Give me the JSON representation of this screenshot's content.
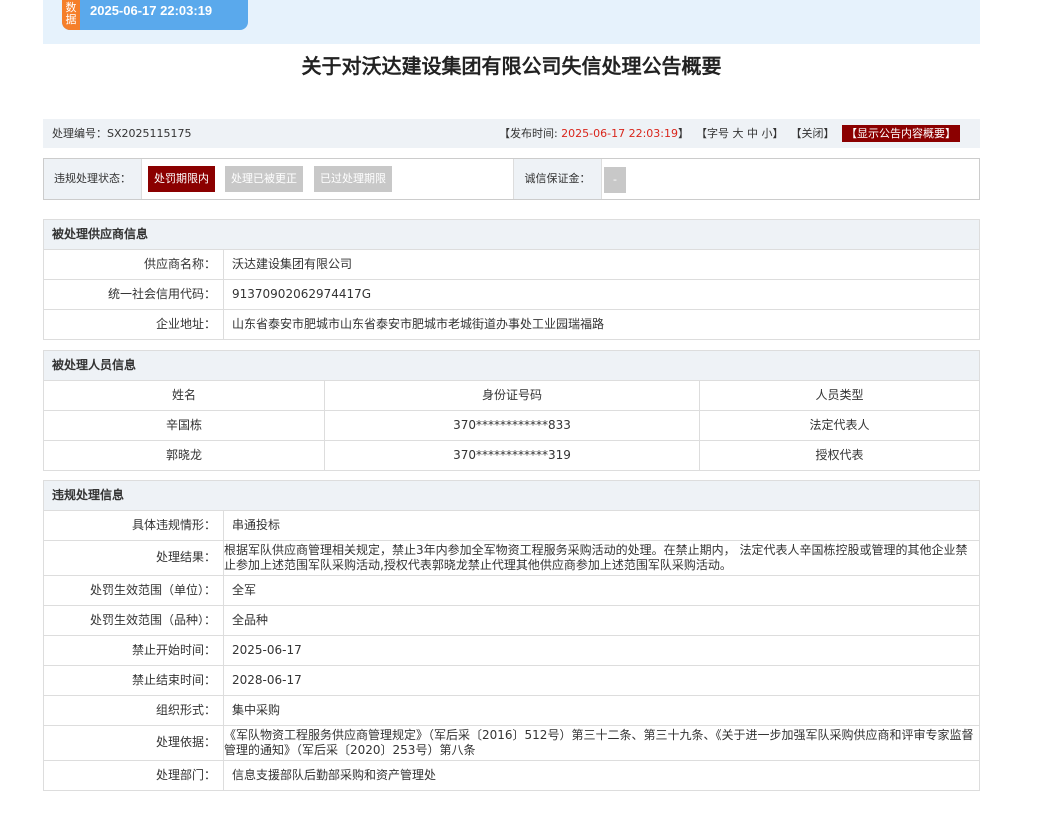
{
  "banner": {
    "tag": "数据",
    "time": "2025-06-17 22:03:19"
  },
  "title": "关于对沃达建设集团有限公司失信处理公告概要",
  "infobar": {
    "number_label": "处理编号：",
    "number": "SX2025115175",
    "publish_label": "【发布时间: ",
    "publish_time": "2025-06-17 22:03:19",
    "publish_end": "】",
    "font_size_label": "【字号",
    "font_big": "大",
    "font_mid": "中",
    "font_small": "小",
    "font_end": "】",
    "close_label": "【关闭】",
    "show_summary": "【显示公告内容概要】"
  },
  "status": {
    "label": "违规处理状态：",
    "buttons": [
      "处罚期限内",
      "处理已被更正",
      "已过处理期限"
    ],
    "deposit_label": "诚信保证金：",
    "deposit_value": "-"
  },
  "supplier": {
    "heading": "被处理供应商信息",
    "rows": [
      {
        "k": "供应商名称：",
        "v": "沃达建设集团有限公司"
      },
      {
        "k": "统一社会信用代码：",
        "v": "91370902062974417G"
      },
      {
        "k": "企业地址：",
        "v": "山东省泰安市肥城市山东省泰安市肥城市老城街道办事处工业园瑞福路"
      }
    ]
  },
  "persons": {
    "heading": "被处理人员信息",
    "headers": [
      "姓名",
      "身份证号码",
      "人员类型"
    ],
    "rows": [
      [
        "辛国栋",
        "370************833",
        "法定代表人"
      ],
      [
        "郭晓龙",
        "370************319",
        "授权代表"
      ]
    ]
  },
  "violation": {
    "heading": "违规处理信息",
    "rows": [
      {
        "k": "具体违规情形：",
        "v": "串通投标"
      },
      {
        "k": "处理结果：",
        "v": "根据军队供应商管理相关规定，禁止3年内参加全军物资工程服务采购活动的处理。在禁止期内， 法定代表人辛国栋控股或管理的其他企业禁止参加上述范围军队采购活动,授权代表郭晓龙禁止代理其他供应商参加上述范围军队采购活动。"
      },
      {
        "k": "处罚生效范围（单位）：",
        "v": "全军"
      },
      {
        "k": "处罚生效范围（品种）：",
        "v": "全品种"
      },
      {
        "k": "禁止开始时间：",
        "v": "2025-06-17"
      },
      {
        "k": "禁止结束时间：",
        "v": "2028-06-17"
      },
      {
        "k": "组织形式：",
        "v": "集中采购"
      },
      {
        "k": "处理依据：",
        "v": "《军队物资工程服务供应商管理规定》（军后采〔2016〕512号）第三十二条、第三十九条、《关于进一步加强军队采购供应商和评审专家监督管理的通知》（军后采〔2020〕253号）第八条"
      },
      {
        "k": "处理部门：",
        "v": "信息支援部队后勤部采购和资产管理处"
      }
    ]
  }
}
